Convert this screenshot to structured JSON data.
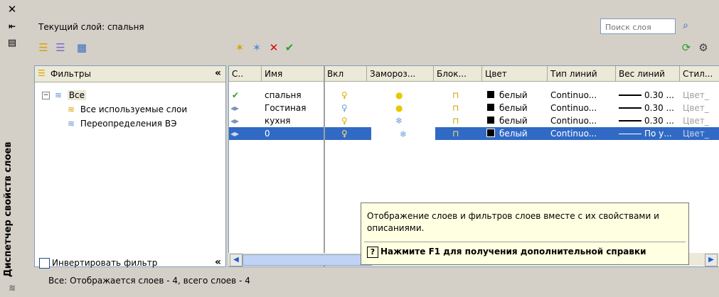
{
  "palette": {
    "panel": "#d4d0c8",
    "selection": "#316ac5",
    "tooltip_bg": "#ffffe1",
    "check": "#2ca02c",
    "delete": "#e00000"
  },
  "titlebar": {
    "title": "Диспетчер свойств слоев",
    "icons": [
      "close-icon",
      "autohide-icon",
      "properties-icon",
      "layers-icon"
    ]
  },
  "header": {
    "current_layer": "Текущий слой: спальня",
    "search_placeholder": "Поиск слоя"
  },
  "filter_panel": {
    "header": "Фильтры",
    "tree": [
      {
        "label": "Все",
        "level": 0
      },
      {
        "label": "Все используемые слои",
        "level": 1
      },
      {
        "label": "Переопределения ВЭ",
        "level": 1
      }
    ],
    "invert_label": "Инвертировать фильтр"
  },
  "table": {
    "columns": [
      "С..",
      "Имя",
      "Вкл",
      "Замороз...",
      "Блок...",
      "Цвет",
      "Тип линий",
      "Вес линий",
      "Стил..."
    ],
    "rows": [
      {
        "status": "current",
        "name": "спальня",
        "color": "белый",
        "linetype": "Continuo...",
        "weight": "0.30 ...",
        "style": "Цвет_",
        "on": true,
        "frozen": false,
        "selected": false
      },
      {
        "status": "layer",
        "name": "Гостиная",
        "color": "белый",
        "linetype": "Continuo...",
        "weight": "0.30 ...",
        "style": "Цвет_",
        "on": false,
        "frozen": false,
        "selected": false
      },
      {
        "status": "layer",
        "name": "кухня",
        "color": "белый",
        "linetype": "Continuo...",
        "weight": "0.30 ...",
        "style": "Цвет_",
        "on": true,
        "frozen": true,
        "selected": false
      },
      {
        "status": "layer",
        "name": "0",
        "color": "белый",
        "linetype": "Continuo...",
        "weight": "По у...",
        "style": "Цвет_",
        "on": true,
        "frozen": true,
        "selected": true
      }
    ]
  },
  "tooltip": {
    "description": "Отображение слоев и фильтров слоев вместе с их свойствами и описаниями.",
    "help": "Нажмите F1 для получения дополнительной справки"
  },
  "status": "Все: Отображается слоев - 4, всего слоев - 4"
}
